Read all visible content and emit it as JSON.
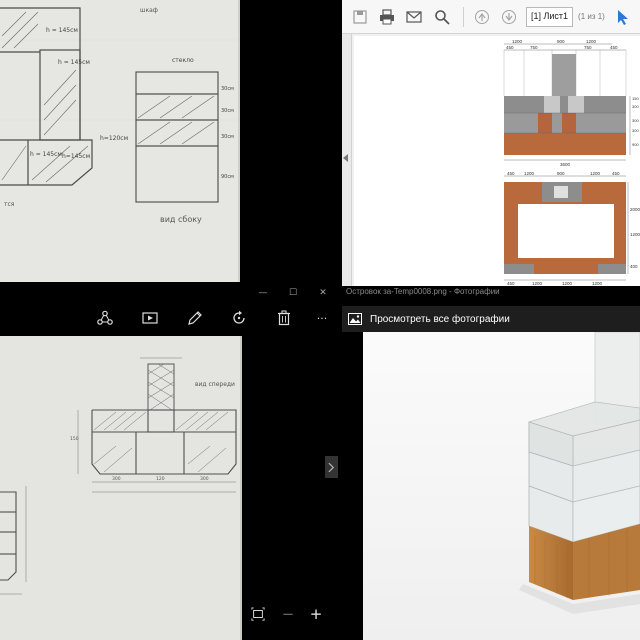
{
  "top_left_sketch": {
    "notes": [
      "шкаф",
      "h = 145см",
      "h = 145см",
      "h=145см",
      "h = 145см",
      "стекло",
      "30см",
      "30см",
      "30см",
      "90см",
      "h=120см",
      "вид сбоку",
      "тся"
    ]
  },
  "pdf_viewer": {
    "toolbar": {
      "page_field": "[1] Лист1",
      "page_count": "(1 из 1)"
    },
    "drawing": {
      "front_dims": [
        "450",
        "750",
        "900",
        "750",
        "450",
        "1200",
        "1200",
        "3600"
      ],
      "height_dims": [
        "150",
        "300",
        "300",
        "300",
        "900",
        "2100"
      ],
      "plan_dims": [
        "450",
        "1200",
        "900",
        "1200",
        "450",
        "1200",
        "1200",
        "1200",
        "450",
        "1200",
        "400",
        "2000"
      ]
    },
    "icons": [
      "save-icon",
      "print-icon",
      "mail-icon",
      "search-icon",
      "arrow-up-icon",
      "arrow-down-icon",
      "cursor-icon"
    ]
  },
  "image_viewer": {
    "window_controls": {
      "minimize": "—",
      "maximize": "☐",
      "close": "✕"
    },
    "toolbar_icons": [
      "share-icon",
      "slideshow-icon",
      "edit-icon",
      "rotate-icon",
      "delete-icon",
      "more-icon"
    ],
    "more_label": "···",
    "sketch_notes": [
      "вид спереди",
      "120",
      "300",
      "300",
      "150"
    ],
    "bottom_icons": [
      "fit-screen-icon",
      "zoom-out-icon",
      "zoom-in-icon"
    ],
    "zoom_out_label": "−",
    "zoom_in_label": "+"
  },
  "photos_app": {
    "title": "Островок за-Temp0008.png - Фотографии",
    "view_all_label": "Просмотреть все фотографии"
  }
}
